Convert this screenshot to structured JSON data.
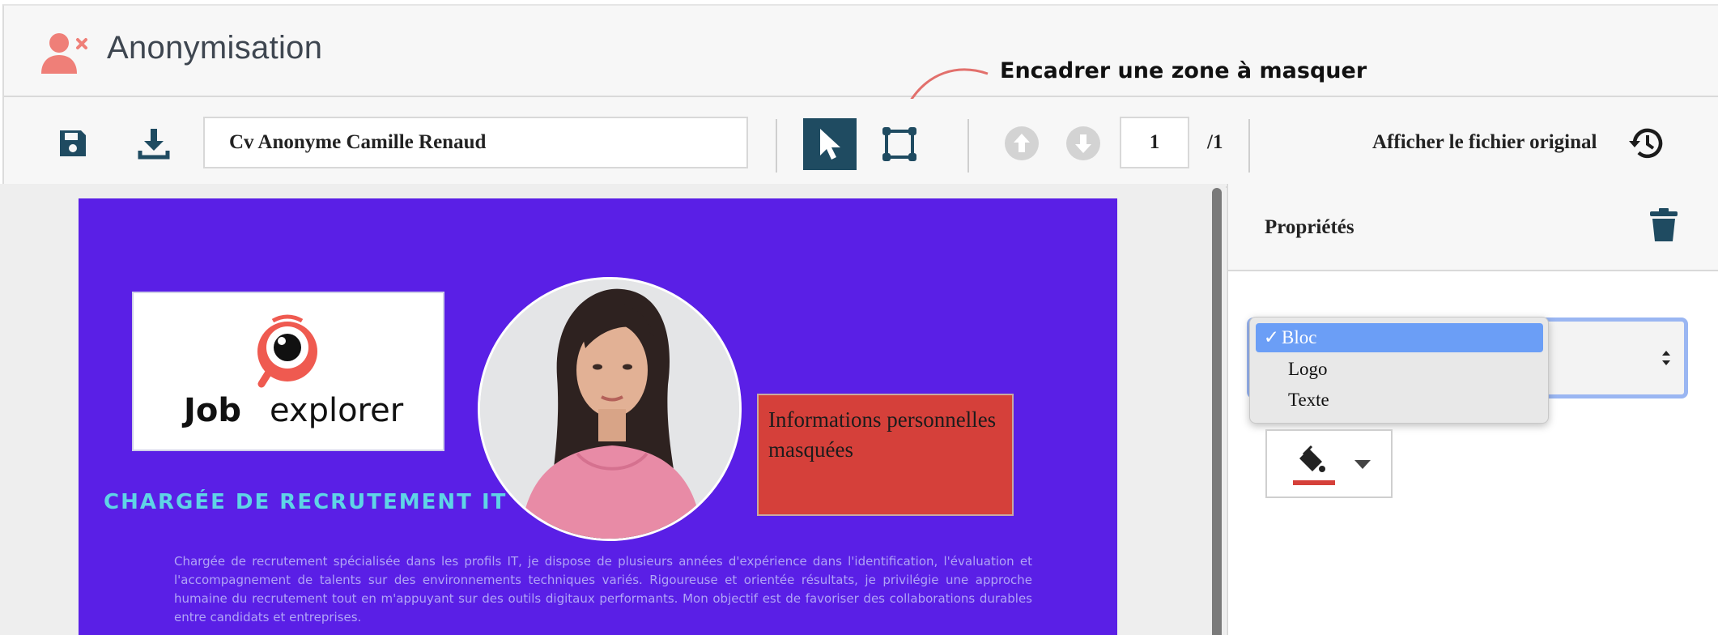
{
  "header": {
    "title": "Anonymisation",
    "icon": "user-remove-icon"
  },
  "annotation": {
    "text": "Encadrer une zone à masquer"
  },
  "toolbar": {
    "save_icon": "save-icon",
    "download_icon": "download-icon",
    "document_name": "Cv Anonyme Camille Renaud",
    "page_current": "1",
    "page_total": "/1",
    "show_original_label": "Afficher le fichier original",
    "history_icon": "history-icon"
  },
  "document": {
    "logo_text_bold": "Job",
    "logo_text_light": "explorer",
    "masked_label": "Informations personnelles masquées",
    "cv_title": "CHARGÉE DE RECRUTEMENT IT",
    "cv_description": "Chargée de recrutement spécialisée dans les profils IT, je dispose de plusieurs années d'expérience dans l'identification, l'évaluation et l'accompagnement de talents sur des environnements techniques variés. Rigoureuse et orientée résultats, je privilégie une approche humaine du recrutement tout en m'appuyant sur des outils digitaux performants. Mon objectif est de favoriser des collaborations durables entre candidats et entreprises."
  },
  "panel": {
    "title": "Propriétés",
    "type_options": [
      "Bloc",
      "Logo",
      "Texte"
    ],
    "selected_option": "Bloc",
    "checkmark": "✓",
    "fill_color": "#d5403a"
  },
  "colors": {
    "accent_dark": "#1f4b61",
    "doc_bg": "#5a1fe6",
    "mask": "#d5403a",
    "title_cyan": "#5fd4e6"
  }
}
